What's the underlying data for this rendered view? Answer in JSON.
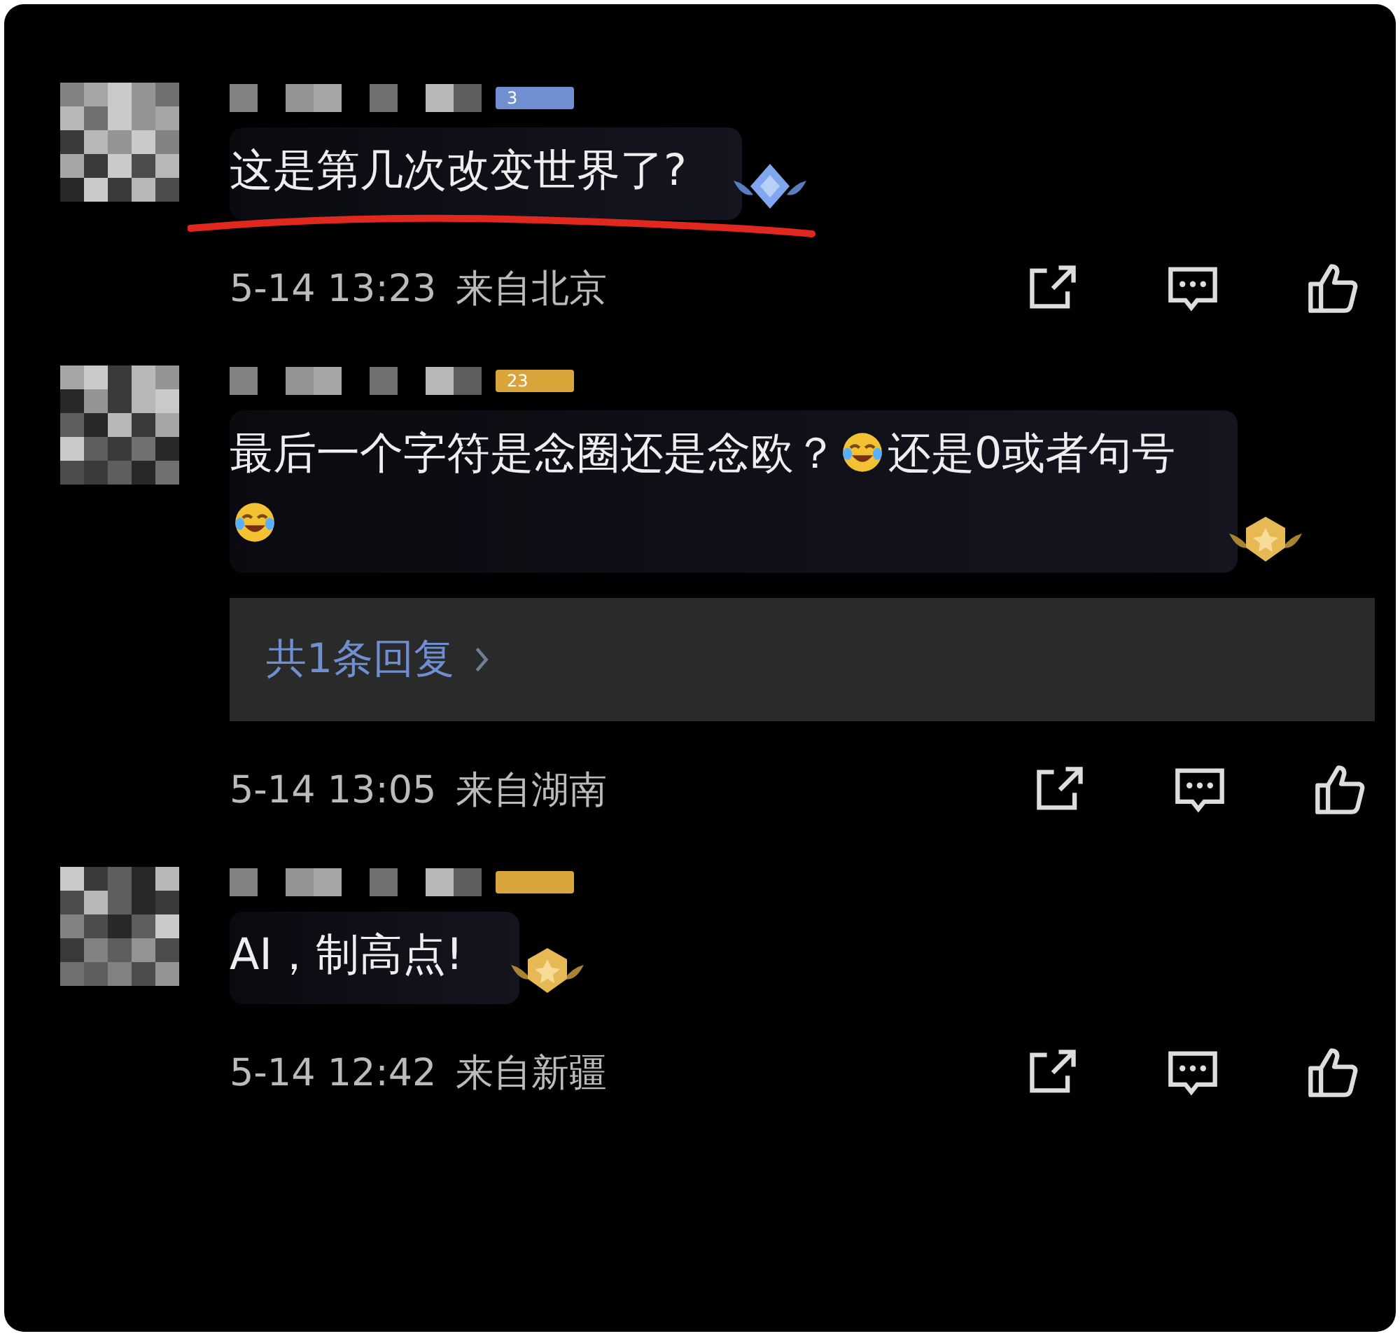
{
  "comments": [
    {
      "level_tag": "3",
      "color": "#6f8fd0",
      "segments": [
        {
          "kind": "text",
          "text": "这是第几次改变世界了?"
        }
      ],
      "underlined": true,
      "badge": {
        "kind": "diamond"
      },
      "time": "5-14 13:23",
      "location": "来自北京"
    },
    {
      "level_tag": "23",
      "color": "#d9a43a",
      "segments": [
        {
          "kind": "text",
          "text": "最后一个字符是念圈还是念欧？"
        },
        {
          "kind": "emoji"
        },
        {
          "kind": "text",
          "text": "还是0或者句号"
        },
        {
          "kind": "emoji"
        }
      ],
      "underlined": false,
      "badge": {
        "kind": "star"
      },
      "replies": "共1条回复",
      "time": "5-14 13:05",
      "location": "来自湖南"
    },
    {
      "color": "#d9a43a",
      "segments": [
        {
          "kind": "text",
          "text": "AI，制高点!"
        }
      ],
      "underlined": false,
      "badge": {
        "kind": "star"
      },
      "time": "5-14 12:42",
      "location": "来自新疆"
    }
  ]
}
